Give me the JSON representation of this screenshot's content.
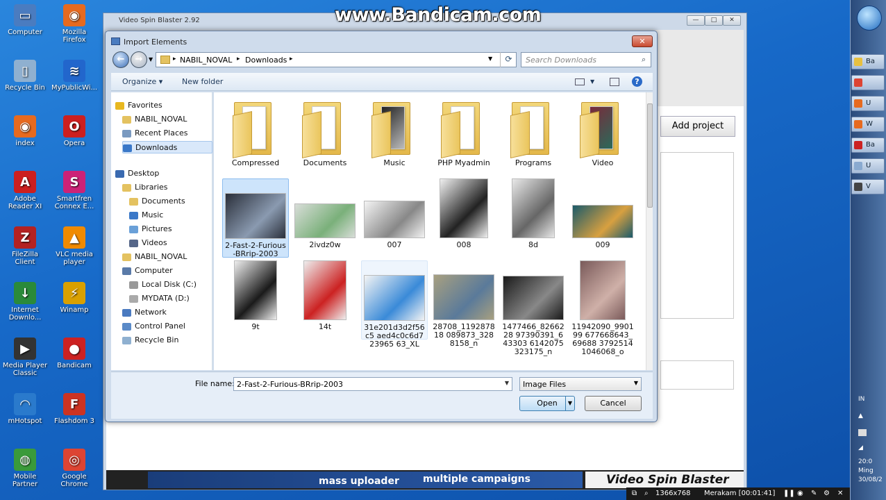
{
  "watermark": "www.Bandicam.com",
  "desktop_icons": [
    {
      "label": "Computer",
      "color": "#4a7cc0",
      "glyph": "▭"
    },
    {
      "label": "Mozilla Firefox",
      "color": "#e66a1f",
      "glyph": "◉"
    },
    {
      "label": "Recycle Bin",
      "color": "#8fb0d0",
      "glyph": "▯"
    },
    {
      "label": "MyPublicWi...",
      "color": "#2266cc",
      "glyph": "≋"
    },
    {
      "label": "index",
      "color": "#e66a1f",
      "glyph": "◉"
    },
    {
      "label": "Opera",
      "color": "#cc1f1f",
      "glyph": "O"
    },
    {
      "label": "Adobe Reader XI",
      "color": "#cc1f1f",
      "glyph": "A"
    },
    {
      "label": "Smartfren Connex E...",
      "color": "#cc2277",
      "glyph": "S"
    },
    {
      "label": "FileZilla Client",
      "color": "#b32222",
      "glyph": "Z"
    },
    {
      "label": "VLC media player",
      "color": "#f08a00",
      "glyph": "▲"
    },
    {
      "label": "Internet Downlo...",
      "color": "#2a8a3a",
      "glyph": "↓"
    },
    {
      "label": "Winamp",
      "color": "#d9a000",
      "glyph": "⚡"
    },
    {
      "label": "Media Player Classic",
      "color": "#333333",
      "glyph": "▶"
    },
    {
      "label": "Bandicam",
      "color": "#cc2222",
      "glyph": "●"
    },
    {
      "label": "mHotspot",
      "color": "#2a7acc",
      "glyph": "◠"
    },
    {
      "label": "Flashdom 3",
      "color": "#cc3322",
      "glyph": "F"
    },
    {
      "label": "Mobile Partner",
      "color": "#3a9a3a",
      "glyph": "◍"
    },
    {
      "label": "Google Chrome",
      "color": "#dd4433",
      "glyph": "◎"
    }
  ],
  "vsb": {
    "title": "Video Spin Blaster 2.92",
    "add_project": "Add project",
    "banner_text_1": "mass uploader",
    "banner_text_2": "multiple campaigns",
    "banner_text_3": "Video Spin Blaster"
  },
  "dialog": {
    "title": "Import Elements",
    "close_glyph": "✕",
    "breadcrumb": [
      "NABIL_NOVAL",
      "Downloads"
    ],
    "search_placeholder": "Search Downloads",
    "toolbar": {
      "organize": "Organize ▾",
      "new_folder": "New folder"
    },
    "nav": [
      {
        "label": "Favorites",
        "indent": 0,
        "color": "#e8b820",
        "selected": false
      },
      {
        "label": "NABIL_NOVAL",
        "indent": 1,
        "color": "#e4c260",
        "selected": false
      },
      {
        "label": "Recent Places",
        "indent": 1,
        "color": "#7a9ac0",
        "selected": false
      },
      {
        "label": "Downloads",
        "indent": 1,
        "color": "#3a78c8",
        "selected": true
      },
      {
        "label": "Desktop",
        "indent": 0,
        "color": "#3a6ab0",
        "selected": false
      },
      {
        "label": "Libraries",
        "indent": 1,
        "color": "#e4c260",
        "selected": false
      },
      {
        "label": "Documents",
        "indent": 2,
        "color": "#e4c260",
        "selected": false
      },
      {
        "label": "Music",
        "indent": 2,
        "color": "#3a78c8",
        "selected": false
      },
      {
        "label": "Pictures",
        "indent": 2,
        "color": "#6aa0d8",
        "selected": false
      },
      {
        "label": "Videos",
        "indent": 2,
        "color": "#556688",
        "selected": false
      },
      {
        "label": "NABIL_NOVAL",
        "indent": 1,
        "color": "#e4c260",
        "selected": false
      },
      {
        "label": "Computer",
        "indent": 1,
        "color": "#5a7aa8",
        "selected": false
      },
      {
        "label": "Local Disk (C:)",
        "indent": 2,
        "color": "#999999",
        "selected": false
      },
      {
        "label": "MYDATA (D:)",
        "indent": 2,
        "color": "#aaaaaa",
        "selected": false
      },
      {
        "label": "Network",
        "indent": 1,
        "color": "#4a7ac0",
        "selected": false
      },
      {
        "label": "Control Panel",
        "indent": 1,
        "color": "#5a8ac8",
        "selected": false
      },
      {
        "label": "Recycle Bin",
        "indent": 1,
        "color": "#8fb0d0",
        "selected": false
      }
    ],
    "files": [
      {
        "name": "Compressed",
        "kind": "folder"
      },
      {
        "name": "Documents",
        "kind": "folder"
      },
      {
        "name": "Music",
        "kind": "folder-img",
        "c1": "#222222",
        "c2": "#bbbbbb"
      },
      {
        "name": "PHP Myadmin",
        "kind": "folder"
      },
      {
        "name": "Programs",
        "kind": "folder"
      },
      {
        "name": "Video",
        "kind": "folder-img",
        "c1": "#7a2a3a",
        "c2": "#2a6a5a"
      },
      {
        "name": "2-Fast-2-Furious-BRrip-2003",
        "kind": "image",
        "c1": "#2a2f3a",
        "c2": "#8a9ab0",
        "w": 88,
        "h": 66,
        "selected": true
      },
      {
        "name": "2ivdz0w",
        "kind": "image",
        "c1": "#d8ddd8",
        "c2": "#7ab07a",
        "w": 88,
        "h": 50
      },
      {
        "name": "007",
        "kind": "image",
        "c1": "#f4f4f4",
        "c2": "#888888",
        "w": 88,
        "h": 54
      },
      {
        "name": "008",
        "kind": "image",
        "c1": "#f0f0f0",
        "c2": "#222222",
        "w": 70,
        "h": 86
      },
      {
        "name": "8d",
        "kind": "image",
        "c1": "#e8e8e8",
        "c2": "#666666",
        "w": 62,
        "h": 86
      },
      {
        "name": "009",
        "kind": "image",
        "c1": "#1a5a6a",
        "c2": "#d8a040",
        "w": 88,
        "h": 48
      },
      {
        "name": "9t",
        "kind": "image",
        "c1": "#eeeeee",
        "c2": "#1a1a1a",
        "w": 62,
        "h": 86
      },
      {
        "name": "14t",
        "kind": "image",
        "c1": "#eeeeee",
        "c2": "#cc2222",
        "w": 62,
        "h": 86
      },
      {
        "name": "31e201d3d2f56c5 aed4c0c6d723965 63_XL",
        "kind": "image",
        "c1": "#f4f4f4",
        "c2": "#3a8ad8",
        "w": 88,
        "h": 66,
        "hover": true
      },
      {
        "name": "28708_119287818 089873_3288158_n",
        "kind": "image",
        "c1": "#a8a080",
        "c2": "#5a7a9a",
        "w": 88,
        "h": 66
      },
      {
        "name": "1477466_8266228 97390391_643303 6142075323175_n",
        "kind": "image",
        "c1": "#1a1a1a",
        "c2": "#888888",
        "w": 88,
        "h": 64
      },
      {
        "name": "11942090_990199 677668643_69688 37925141046068_o",
        "kind": "image",
        "c1": "#7a5a5a",
        "c2": "#cfb0a8",
        "w": 66,
        "h": 86
      }
    ],
    "file_name_label": "File name:",
    "file_name_value": "2-Fast-2-Furious-BRrip-2003",
    "file_type": "Image Files",
    "open": "Open",
    "cancel": "Cancel"
  },
  "taskbar_items": [
    {
      "label": "Ba",
      "color": "#e8c040"
    },
    {
      "label": "",
      "color": "#dd4433"
    },
    {
      "label": "U",
      "color": "#e66a1f"
    },
    {
      "label": "W",
      "color": "#e66a1f"
    },
    {
      "label": "Ba",
      "color": "#cc2222"
    },
    {
      "label": "U",
      "color": "#8aaad0"
    },
    {
      "label": "V",
      "color": "#444444"
    }
  ],
  "tray": {
    "lang": "IN",
    "time": "20:0",
    "day": "Ming",
    "date": "30/08/2"
  },
  "bandicam_status": {
    "resolution": "1366x768",
    "recording": "Merakam [00:01:41]"
  }
}
